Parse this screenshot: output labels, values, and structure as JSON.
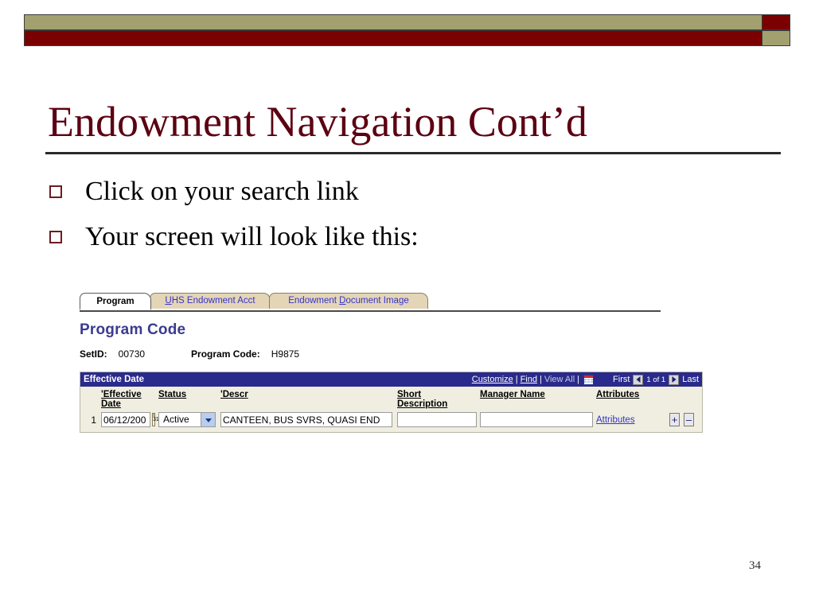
{
  "slide": {
    "title": "Endowment Navigation Cont’d",
    "page_number": "34",
    "accent_color": "#5c0011",
    "banner_olive": "#a3a070",
    "banner_maroon": "#7b0000",
    "bullets": [
      {
        "text": "Click on your search link"
      },
      {
        "text": "Your screen will look like this:"
      }
    ]
  },
  "app": {
    "tabs": [
      {
        "label": "Program",
        "active": true,
        "accel": "",
        "rest": "Program"
      },
      {
        "label": "UHS Endowment Acct",
        "active": false,
        "accel": "U",
        "rest": "HS Endowment Acct"
      },
      {
        "label": "Endowment Document Image",
        "active": false,
        "accel": "D",
        "pre": "Endowment ",
        "rest": "ocument Image"
      }
    ],
    "page_heading": "Program Code",
    "key_fields": {
      "setid_label": "SetID:",
      "setid_value": "00730",
      "program_code_label": "Program Code:",
      "program_code_value": "H9875"
    },
    "grid": {
      "title": "Effective Date",
      "actions": {
        "customize": "Customize",
        "find": "Find",
        "view_all": "View All",
        "separator": "|",
        "grid_icon": "spreadsheet-grid-icon"
      },
      "pager": {
        "first": "First",
        "prev_icon": "left-triangle-icon",
        "count": "1 of 1",
        "count_prefix": "1",
        "count_middle": "of",
        "count_suffix": "1",
        "next_icon": "right-triangle-icon",
        "last": "Last"
      },
      "columns": [
        {
          "key": "rownum",
          "label": ""
        },
        {
          "key": "effective_date",
          "label": "'Effective Date"
        },
        {
          "key": "status",
          "label": "Status"
        },
        {
          "key": "descr",
          "label": "'Descr"
        },
        {
          "key": "short_description",
          "label": "Short Description"
        },
        {
          "key": "manager_name",
          "label": "Manager Name"
        },
        {
          "key": "attributes",
          "label": "Attributes"
        }
      ],
      "column_labels": {
        "effective_date_line1": "'Effective",
        "effective_date_line2": "Date",
        "status": "Status",
        "descr": "'Descr",
        "short_line1": "Short",
        "short_line2": "Description",
        "manager_name": "Manager Name",
        "attributes": "Attributes"
      },
      "rows": [
        {
          "number": "1",
          "effective_date": "06/12/200",
          "calendar_icon_label": "31",
          "status": "Active",
          "status_options": "Active",
          "descr": "CANTEEN, BUS SVRS, QUASI END",
          "short_description": "",
          "manager_name": "",
          "attributes_link": "Attributes",
          "add_row_label": "+",
          "delete_row_label": "–"
        }
      ]
    }
  }
}
